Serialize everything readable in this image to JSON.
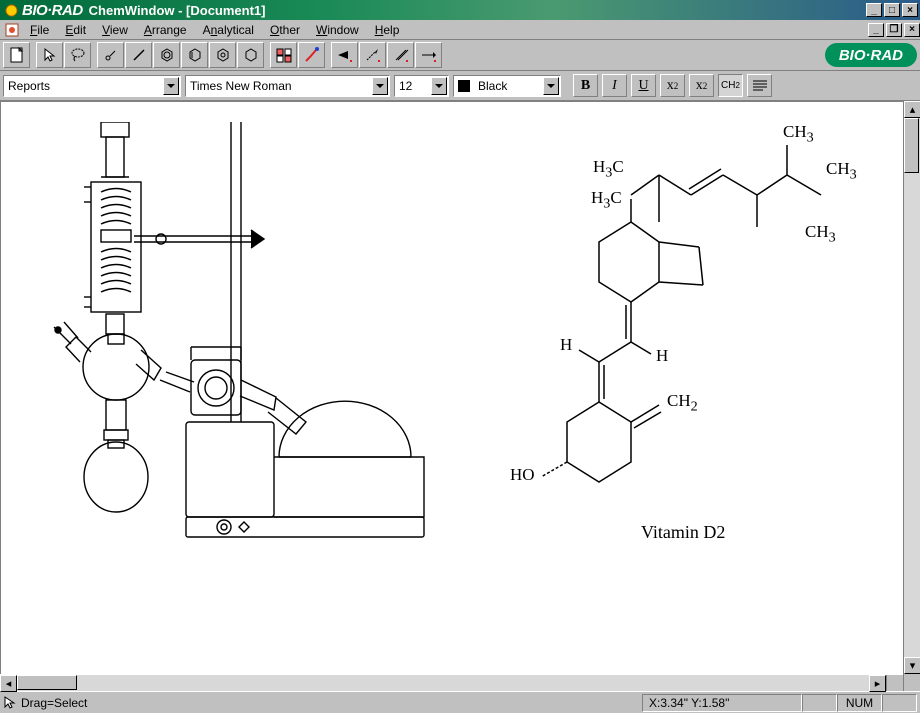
{
  "title": {
    "brand": "BIO·RAD",
    "windowTitle": "ChemWindow - [Document1]"
  },
  "menu": {
    "items": [
      "File",
      "Edit",
      "View",
      "Arrange",
      "Analytical",
      "Other",
      "Window",
      "Help"
    ]
  },
  "toolbar": {
    "buttons": [
      "new-document",
      "pointer",
      "lasso",
      "atom-tool",
      "bond-tool",
      "benzene",
      "ring-tool",
      "cyclohexane",
      "hexagon",
      "periodic-table",
      "brush-red",
      "arrow-black-red",
      "arrow-red",
      "bond-slash",
      "arrow-right"
    ],
    "brandLogo": "BIO·RAD"
  },
  "format": {
    "styleCombo": "Reports",
    "fontCombo": "Times New Roman",
    "sizeCombo": "12",
    "colorLabel": "Black",
    "bold": "B",
    "italic": "I",
    "underline": "U",
    "subscript": "x",
    "subscript2": "2",
    "superscript": "x",
    "superscript2": "2",
    "ch2": "CH",
    "ch2sub": "2"
  },
  "document": {
    "moleculeName": "Vitamin D2",
    "labels": {
      "ch3_1": "CH",
      "ch3_1s": "3",
      "h3c_1": "H",
      "h3c_1s": "3",
      "h3c_1c": "C",
      "ch3_2": "CH",
      "ch3_2s": "3",
      "h3c_2": "H",
      "h3c_2s": "3",
      "h3c_2c": "C",
      "ch3_3": "CH",
      "ch3_3s": "3",
      "h_1": "H",
      "h_2": "H",
      "ch2": "CH",
      "ch2s": "2",
      "ho": "HO"
    }
  },
  "status": {
    "hint": "Drag=Select",
    "coords": "X:3.34\" Y:1.58\"",
    "num": "NUM"
  }
}
